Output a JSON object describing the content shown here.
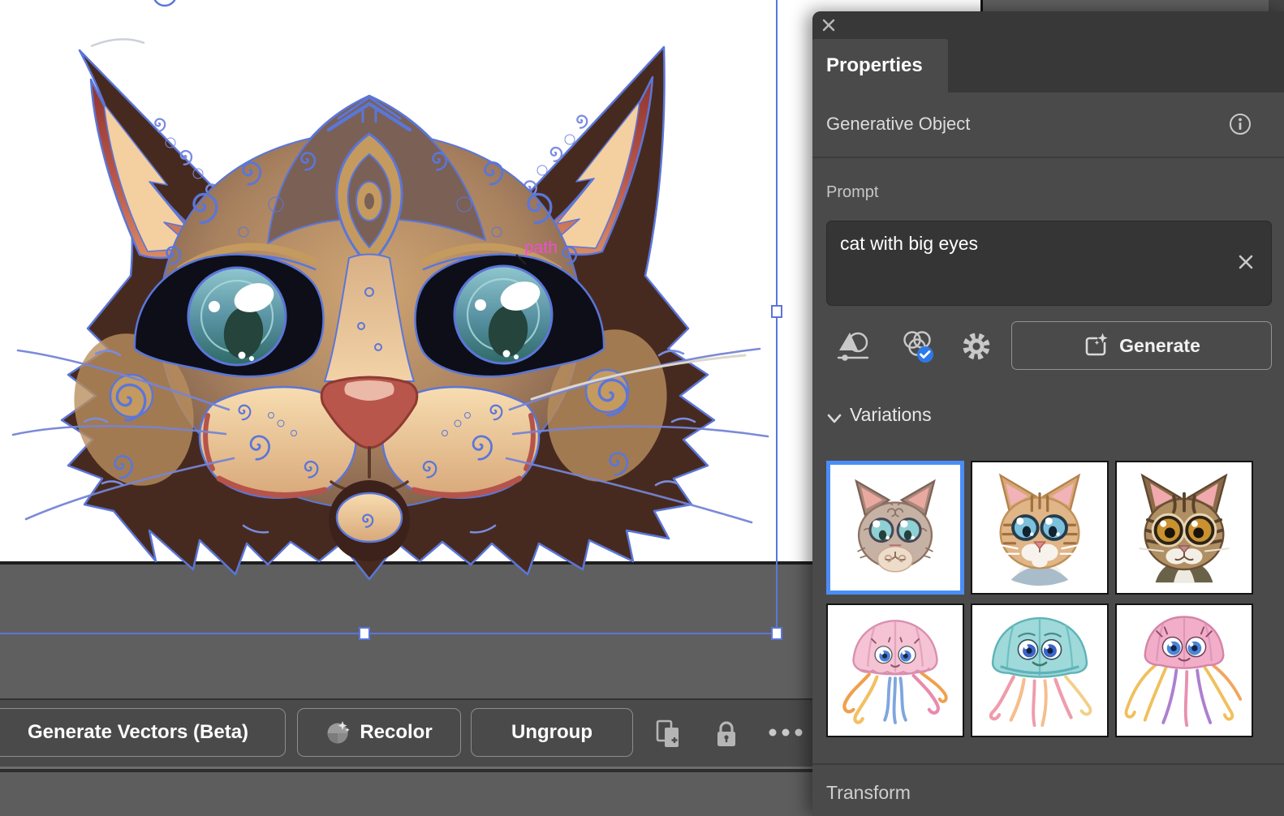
{
  "colors": {
    "accent_blue": "#4B8DF6",
    "selection_blue": "#5B76D9",
    "smart_guide_magenta": "#EE4FD2",
    "panel_background": "#4A4A4A",
    "canvas_white": "#FFFFFF"
  },
  "canvas": {
    "smart_guide_label": "path",
    "artwork_description": "ornate mandala-style cat face vector illustration, selected"
  },
  "properties_panel": {
    "close_icon": "x",
    "tab_label": "Properties",
    "object_type": "Generative Object",
    "info_icon": "info-circle",
    "prompt_label": "Prompt",
    "prompt_value": "cat with big eyes",
    "prompt_clear_icon": "x",
    "tool_icons": [
      "style-reference-icon",
      "color-harmony-check-icon",
      "settings-gear-icon"
    ],
    "generate_icon": "generate-sparkle-icon",
    "generate_label": "Generate",
    "variations_title": "Variations",
    "variations": {
      "items": [
        {
          "name": "ornate mandala cat with teal eyes",
          "selected": true
        },
        {
          "name": "sandy tabby cat with big blue eyes",
          "selected": false
        },
        {
          "name": "brown tabby cat with amber eyes",
          "selected": false
        },
        {
          "name": "pink jellyfish with orange blue and pink tentacles",
          "selected": false
        },
        {
          "name": "teal jellyfish with pink and peach tentacles",
          "selected": false
        },
        {
          "name": "pink jellyfish with long yellow and purple tentacles",
          "selected": false
        }
      ]
    },
    "transform_title": "Transform"
  },
  "task_bar": {
    "buttons": [
      {
        "label": "Generate Vectors (Beta)"
      },
      {
        "label": "Recolor"
      },
      {
        "label": "Ungroup"
      }
    ],
    "icons": [
      "duplicate-icon",
      "lock-icon",
      "more-options-icon"
    ]
  }
}
